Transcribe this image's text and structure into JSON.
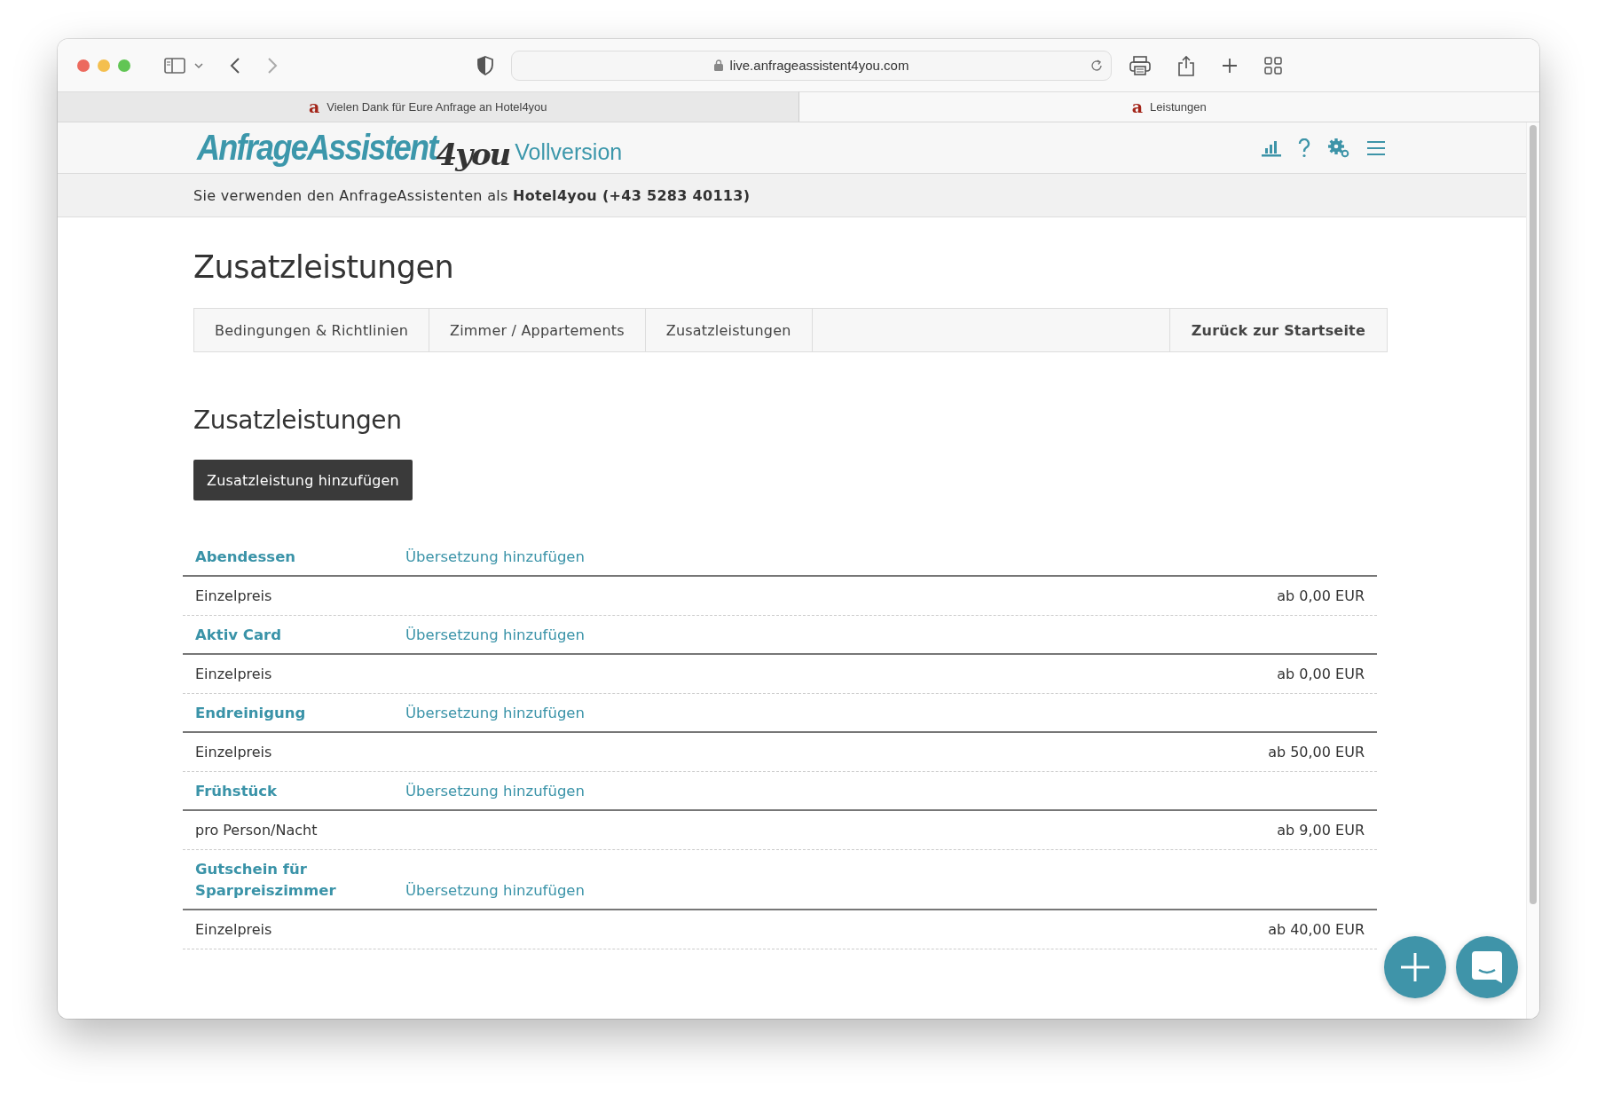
{
  "browser": {
    "url": "live.anfrageassistent4you.com",
    "tabs": [
      {
        "favicon": "a",
        "title": "Vielen Dank für Eure Anfrage an Hotel4you",
        "selected": false
      },
      {
        "favicon": "a",
        "title": "Leistungen",
        "selected": true
      }
    ]
  },
  "header": {
    "logo": {
      "main": "AnfrageAssistent",
      "script": "4you",
      "edition": "Vollversion"
    }
  },
  "info_bar": "Sie verwenden den AnfrageAssistenten als **Hotel4you (+43 5283 40113)**",
  "page_title": "Zusatzleistungen",
  "nav_tabs": [
    "Bedingungen & Richtlinien",
    "Zimmer / Appartements",
    "Zusatzleistungen"
  ],
  "back_button": "Zurück zur Startseite",
  "section_title": "Zusatzleistungen",
  "add_button": "Zusatzleistung hinzufügen",
  "services": [
    {
      "name": "Abendessen",
      "translation_link": "Übersetzung hinzufügen",
      "pricing": "Einzelpreis",
      "price": "ab 0,00 EUR"
    },
    {
      "name": "Aktiv Card",
      "translation_link": "Übersetzung hinzufügen",
      "pricing": "Einzelpreis",
      "price": "ab 0,00 EUR"
    },
    {
      "name": "Endreinigung",
      "translation_link": "Übersetzung hinzufügen",
      "pricing": "Einzelpreis",
      "price": "ab 50,00 EUR"
    },
    {
      "name": "Frühstück",
      "translation_link": "Übersetzung hinzufügen",
      "pricing": "pro Person/Nacht",
      "price": "ab 9,00 EUR"
    },
    {
      "name": "Gutschein für Sparpreiszimmer",
      "translation_link": "Übersetzung hinzufügen",
      "pricing": "Einzelpreis",
      "price": "ab 40,00 EUR"
    }
  ]
}
